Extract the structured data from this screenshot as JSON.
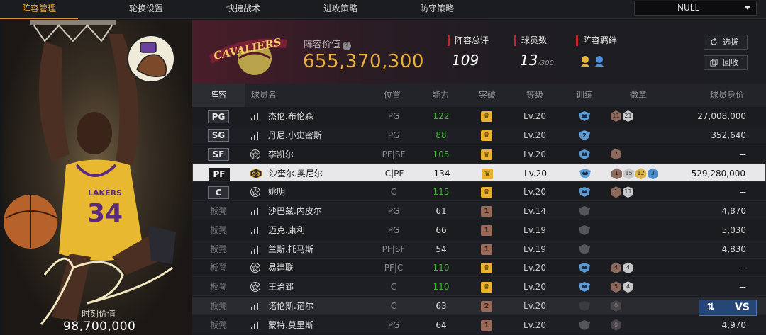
{
  "nav": {
    "tabs": [
      "阵容管理",
      "轮换设置",
      "快捷战术",
      "进攻策略",
      "防守策略"
    ],
    "active_tab": 0,
    "select_value": "NULL"
  },
  "featured_player": {
    "value_label": "时刻价值",
    "value": "98,700,000",
    "jersey_number": "34",
    "jersey_text": "LAKERS"
  },
  "team": {
    "logo_text": "CAVALIERS",
    "value_label": "阵容价值",
    "value": "655,370,300",
    "stats": [
      {
        "label": "阵容总评",
        "value": "109",
        "suffix": ""
      },
      {
        "label": "球员数",
        "value": "13",
        "suffix": "/300"
      },
      {
        "label": "阵容羁绊",
        "value": "",
        "suffix": ""
      }
    ],
    "buttons": {
      "select": "选拔",
      "recycle": "回收"
    }
  },
  "table": {
    "headers": {
      "lineup": "阵容",
      "name": "球员名",
      "position": "位置",
      "rating": "能力",
      "breakthrough": "突破",
      "level": "等级",
      "training": "训练",
      "badges": "徽章",
      "value": "球员身价"
    },
    "rows": [
      {
        "slot": "PG",
        "bench": false,
        "name": "杰伦.布伦森",
        "pos": "PG",
        "rating": "122",
        "green": true,
        "brk": "gold",
        "lv": "Lv.20",
        "train": "blue",
        "badges": [
          [
            "bronze",
            "11"
          ],
          [
            "silver",
            "21"
          ]
        ],
        "value": "27,008,000"
      },
      {
        "slot": "SG",
        "bench": false,
        "name": "丹尼.小史密斯",
        "pos": "PG",
        "rating": "88",
        "green": true,
        "brk": "gold",
        "lv": "Lv.20",
        "train": "blue2",
        "badges": [],
        "value": "352,640"
      },
      {
        "slot": "SF",
        "bench": false,
        "name": "李凯尔",
        "pos": "PF|SF",
        "rating": "105",
        "green": true,
        "brk": "gold",
        "lv": "Lv.20",
        "train": "blue",
        "badges": [
          [
            "bronze",
            "7"
          ]
        ],
        "value": "--"
      },
      {
        "slot": "PF",
        "bench": false,
        "name": "沙奎尔.奥尼尔",
        "pos": "C|PF",
        "rating": "134",
        "green": false,
        "brk": "gold",
        "lv": "Lv.20",
        "train": "blue",
        "badges": [
          [
            "bronze",
            "1"
          ],
          [
            "silver",
            "15"
          ],
          [
            "gold",
            "12"
          ],
          [
            "blue",
            "3"
          ]
        ],
        "value": "529,280,000",
        "selected": true,
        "star": "99"
      },
      {
        "slot": "C",
        "bench": false,
        "name": "姚明",
        "pos": "C",
        "rating": "115",
        "green": true,
        "brk": "gold",
        "lv": "Lv.20",
        "train": "blue",
        "badges": [
          [
            "bronze",
            "1"
          ],
          [
            "silver",
            "11"
          ]
        ],
        "value": "--"
      },
      {
        "slot": "板凳",
        "bench": true,
        "name": "沙巴兹.内皮尔",
        "pos": "PG",
        "rating": "61",
        "green": false,
        "brk": "brown",
        "brkText": "1",
        "lv": "Lv.14",
        "train": "gray",
        "badges": [],
        "value": "4,870"
      },
      {
        "slot": "板凳",
        "bench": true,
        "name": "迈克.康利",
        "pos": "PG",
        "rating": "66",
        "green": false,
        "brk": "brown",
        "brkText": "1",
        "lv": "Lv.19",
        "train": "gray",
        "badges": [],
        "value": "5,030"
      },
      {
        "slot": "板凳",
        "bench": true,
        "name": "兰斯.托马斯",
        "pos": "PF|SF",
        "rating": "54",
        "green": false,
        "brk": "brown",
        "brkText": "1",
        "lv": "Lv.19",
        "train": "gray",
        "badges": [],
        "value": "4,830"
      },
      {
        "slot": "板凳",
        "bench": true,
        "name": "易建联",
        "pos": "PF|C",
        "rating": "110",
        "green": true,
        "brk": "gold",
        "lv": "Lv.20",
        "train": "blue",
        "badges": [
          [
            "bronze",
            "4"
          ],
          [
            "silver",
            "4"
          ]
        ],
        "value": "--"
      },
      {
        "slot": "板凳",
        "bench": true,
        "name": "王治郅",
        "pos": "C",
        "rating": "110",
        "green": true,
        "brk": "gold",
        "lv": "Lv.20",
        "train": "blue",
        "badges": [
          [
            "bronze",
            "5"
          ],
          [
            "silver",
            "4"
          ]
        ],
        "value": "--"
      },
      {
        "slot": "板凳",
        "bench": true,
        "name": "诺伦斯.诺尔",
        "pos": "C",
        "rating": "63",
        "green": false,
        "brk": "brown",
        "brkText": "2",
        "lv": "Lv.20",
        "train": "dark",
        "badges": [
          [
            "dark",
            "0"
          ]
        ],
        "value": "",
        "dim": true
      },
      {
        "slot": "板凳",
        "bench": true,
        "name": "蒙特.莫里斯",
        "pos": "PG",
        "rating": "64",
        "green": false,
        "brk": "brown",
        "brkText": "1",
        "lv": "Lv.20",
        "train": "gray",
        "badges": [
          [
            "dark",
            "0"
          ]
        ],
        "value": "4,970"
      }
    ]
  },
  "vs_button": {
    "label": "VS"
  },
  "colors": {
    "accent": "#e0a638",
    "green": "#3fb232",
    "header_red": "#c8222f"
  }
}
